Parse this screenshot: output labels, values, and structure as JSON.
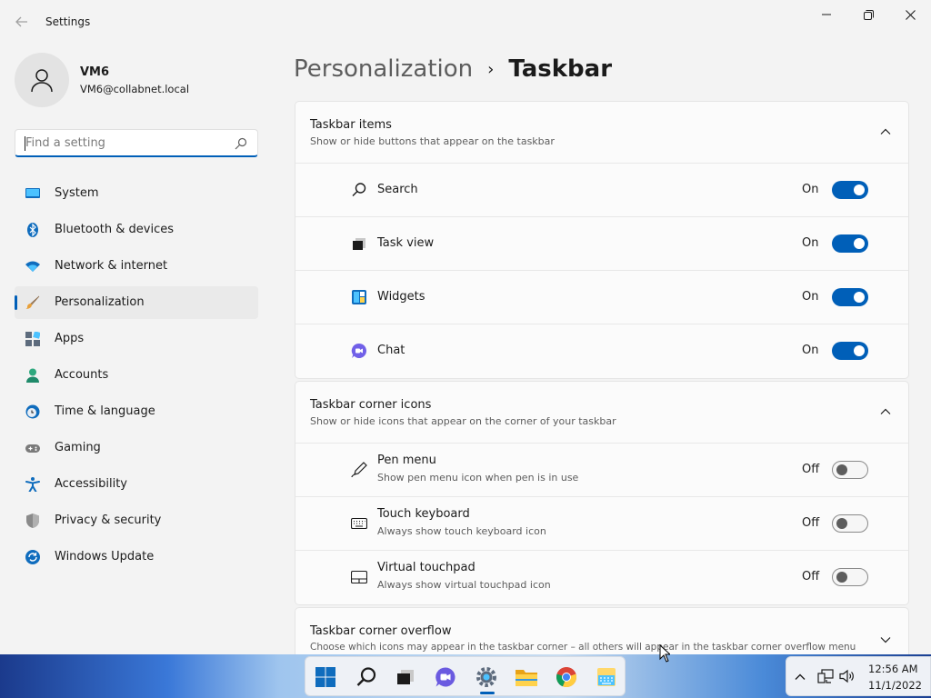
{
  "window": {
    "title": "Settings"
  },
  "user": {
    "name": "VM6",
    "email": "VM6@collabnet.local"
  },
  "search": {
    "placeholder": "Find a setting"
  },
  "sidebar": {
    "items": [
      {
        "label": "System",
        "icon": "monitor-icon"
      },
      {
        "label": "Bluetooth & devices",
        "icon": "bluetooth-icon"
      },
      {
        "label": "Network & internet",
        "icon": "wifi-icon"
      },
      {
        "label": "Personalization",
        "icon": "brush-icon",
        "active": true
      },
      {
        "label": "Apps",
        "icon": "apps-icon"
      },
      {
        "label": "Accounts",
        "icon": "person-icon"
      },
      {
        "label": "Time & language",
        "icon": "clock-globe-icon"
      },
      {
        "label": "Gaming",
        "icon": "gamepad-icon"
      },
      {
        "label": "Accessibility",
        "icon": "accessibility-icon"
      },
      {
        "label": "Privacy & security",
        "icon": "shield-icon"
      },
      {
        "label": "Windows Update",
        "icon": "refresh-icon"
      }
    ]
  },
  "breadcrumb": {
    "parent": "Personalization",
    "separator": "›",
    "current": "Taskbar"
  },
  "sections": {
    "taskbar_items": {
      "title": "Taskbar items",
      "subtitle": "Show or hide buttons that appear on the taskbar",
      "rows": [
        {
          "label": "Search",
          "state": "On",
          "icon": "search-icon"
        },
        {
          "label": "Task view",
          "state": "On",
          "icon": "task-view-icon"
        },
        {
          "label": "Widgets",
          "state": "On",
          "icon": "widgets-icon"
        },
        {
          "label": "Chat",
          "state": "On",
          "icon": "chat-icon"
        }
      ]
    },
    "corner_icons": {
      "title": "Taskbar corner icons",
      "subtitle": "Show or hide icons that appear on the corner of your taskbar",
      "rows": [
        {
          "label": "Pen menu",
          "sub": "Show pen menu icon when pen is in use",
          "state": "Off",
          "icon": "pen-icon"
        },
        {
          "label": "Touch keyboard",
          "sub": "Always show touch keyboard icon",
          "state": "Off",
          "icon": "keyboard-icon"
        },
        {
          "label": "Virtual touchpad",
          "sub": "Always show virtual touchpad icon",
          "state": "Off",
          "icon": "touchpad-icon"
        }
      ]
    },
    "corner_overflow": {
      "title": "Taskbar corner overflow",
      "subtitle": "Choose which icons may appear in the taskbar corner – all others will appear in the taskbar corner overflow menu"
    }
  },
  "clock": {
    "time": "12:56 AM",
    "date": "11/1/2022"
  },
  "colors": {
    "accent": "#005fb8",
    "background": "#f3f3f3",
    "card": "#fbfbfb"
  }
}
